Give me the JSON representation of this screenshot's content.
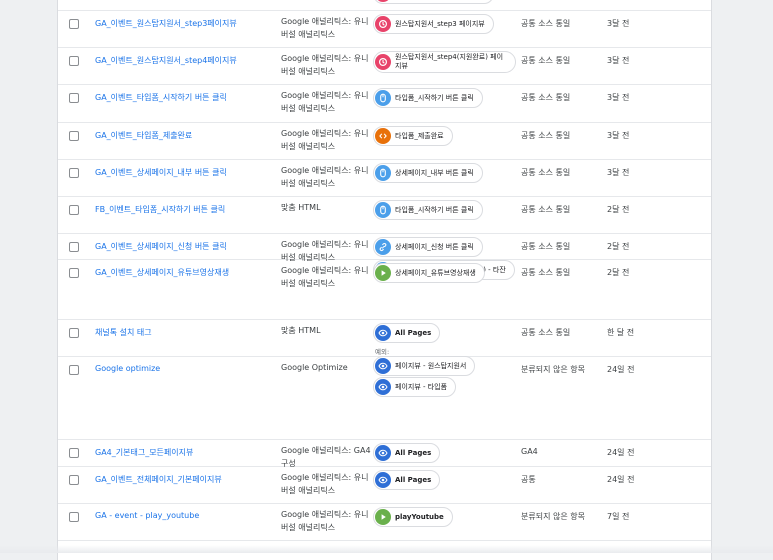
{
  "rows": [
    {
      "name": "GA_이벤트_원스탑지원서_step2페이지뷰",
      "type": [
        "",
        "버설 애널리틱스"
      ],
      "triggers": [
        {
          "icon": "history",
          "label": "원스탑지원서_step2 페이지뷰"
        }
      ],
      "folder": "공통 소스 통일",
      "time": "3달 전"
    },
    {
      "name": "GA_이벤트_원스탑지원서_step3페이지뷰",
      "type": [
        "Google 애널리틱스: 유니",
        "버설 애널리틱스"
      ],
      "triggers": [
        {
          "icon": "history",
          "label": "원스탑지원서_step3 페이지뷰"
        }
      ],
      "folder": "공통 소스 통일",
      "time": "3달 전"
    },
    {
      "name": "GA_이벤트_원스탑지원서_step4페이지뷰",
      "type": [
        "Google 애널리틱스: 유니",
        "버설 애널리틱스"
      ],
      "triggers": [
        {
          "icon": "history",
          "label": "원스탑지원서_step4(지원완료) 페이지뷰"
        }
      ],
      "folder": "공통 소스 통일",
      "time": "3달 전"
    },
    {
      "name": "GA_이벤트_타입폼_시작하기 버튼 클릭",
      "type": [
        "Google 애널리틱스: 유니",
        "버설 애널리틱스"
      ],
      "triggers": [
        {
          "icon": "mouse",
          "label": "타입폼_시작하기 버튼 클릭"
        }
      ],
      "folder": "공통 소스 통일",
      "time": "3달 전"
    },
    {
      "name": "GA_이벤트_타입폼_제출완료",
      "type": [
        "Google 애널리틱스: 유니",
        "버설 애널리틱스"
      ],
      "triggers": [
        {
          "icon": "code",
          "label": "타입폼_제출완료"
        }
      ],
      "folder": "공통 소스 통일",
      "time": "3달 전"
    },
    {
      "name": "GA_이벤트_상세페이지_내부 버튼 클릭",
      "type": [
        "Google 애널리틱스: 유니",
        "버설 애널리틱스"
      ],
      "triggers": [
        {
          "icon": "mouse",
          "label": "상세페이지_내부 버튼 클릭"
        }
      ],
      "folder": "공통 소스 통일",
      "time": "3달 전"
    },
    {
      "name": "FB_이벤트_타입폼_시작하기 버튼 클릭",
      "type": [
        "맞춤 HTML"
      ],
      "triggers": [
        {
          "icon": "mouse",
          "label": "타입폼_시작하기 버튼 클릭"
        }
      ],
      "folder": "공통 소스 통일",
      "time": "2달 전"
    },
    {
      "name": "GA_이벤트_상세페이지_신청 버튼 클릭",
      "type": [
        "Google 애널리틱스: 유니",
        "버설 애널리틱스"
      ],
      "triggers": [
        {
          "icon": "link",
          "label": "상세페이지_신청 버튼 클릭"
        },
        {
          "icon": "link",
          "label": "상세페이지_신청 버튼 클릭 (2) - 타잔"
        }
      ],
      "folder": "공통 소스 통일",
      "time": "2달 전"
    },
    {
      "name": "GA_이벤트_상세페이지_유튜브영상재생",
      "type": [
        "Google 애널리틱스: 유니",
        "버설 애널리틱스"
      ],
      "triggers": [
        {
          "icon": "play",
          "label": "상세페이지_유튜브영상재생"
        }
      ],
      "folder": "공통 소스 통일",
      "time": "2달 전"
    },
    {
      "name": "채널톡 설치 태그",
      "type": [
        "맞춤 HTML"
      ],
      "triggers": [
        {
          "icon": "eye",
          "label": "All Pages",
          "bold": true
        }
      ],
      "exceptions_label": "예외:",
      "exceptions": [
        {
          "icon": "eye",
          "label": "페이지뷰 - 원스탑지원서"
        },
        {
          "icon": "eye",
          "label": "페이지뷰 - 타입폼"
        }
      ],
      "folder": "공통 소스 통일",
      "time": "한 달 전"
    },
    {
      "name": "Google optimize",
      "type": [
        "Google Optimize"
      ],
      "triggers": [],
      "folder": "분류되지 않은 항목",
      "time": "24일 전"
    },
    {
      "name": "GA4_기본태그_모든페이지뷰",
      "type": [
        "Google 애널리틱스: GA4",
        "구성"
      ],
      "triggers": [
        {
          "icon": "eye",
          "label": "All Pages",
          "bold": true
        }
      ],
      "folder": "GA4",
      "time": "24일 전"
    },
    {
      "name": "GA_이벤트_전체페이지_기본페이지뷰",
      "type": [
        "Google 애널리틱스: 유니",
        "버설 애널리틱스"
      ],
      "triggers": [
        {
          "icon": "eye",
          "label": "All Pages",
          "bold": true
        }
      ],
      "folder": "공통",
      "time": "24일 전"
    },
    {
      "name": "GA - event - play_youtube",
      "type": [
        "Google 애널리틱스: 유니",
        "버설 애널리틱스"
      ],
      "triggers": [
        {
          "icon": "play",
          "label": "playYoutube",
          "bold": true
        }
      ],
      "folder": "분류되지 않은 항목",
      "time": "7일 전"
    }
  ],
  "icon_colors": {
    "history": "#e8436a",
    "mouse": "#4b9fea",
    "code": "#e8710a",
    "link": "#4b9fea",
    "play": "#6ab04c",
    "eye": "#2f6fd6"
  }
}
